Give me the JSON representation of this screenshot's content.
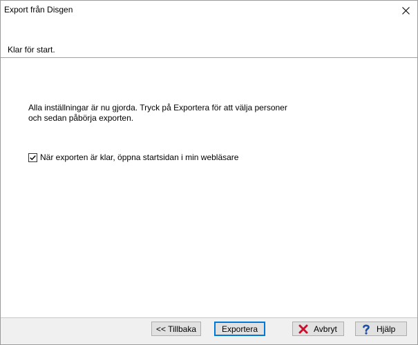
{
  "window": {
    "title": "Export från Disgen"
  },
  "header": {
    "status": "Klar för start."
  },
  "main": {
    "description_line1": "Alla inställningar är nu gjorda. Tryck på Exportera för att välja personer",
    "description_line2": "och sedan påbörja exporten.",
    "open_browser_checkbox": {
      "label": "När exporten är klar, öppna startsidan i min webläsare",
      "checked": true
    }
  },
  "footer": {
    "back_label": "<< Tillbaka",
    "export_label": "Exportera",
    "cancel_label": "Avbryt",
    "help_label_prefix": "H",
    "help_label_accel": "j",
    "help_label_suffix": "älp"
  },
  "colors": {
    "cancel_icon": "#c8102e",
    "help_icon": "#1f4fa3",
    "focus_border": "#0078d7"
  }
}
